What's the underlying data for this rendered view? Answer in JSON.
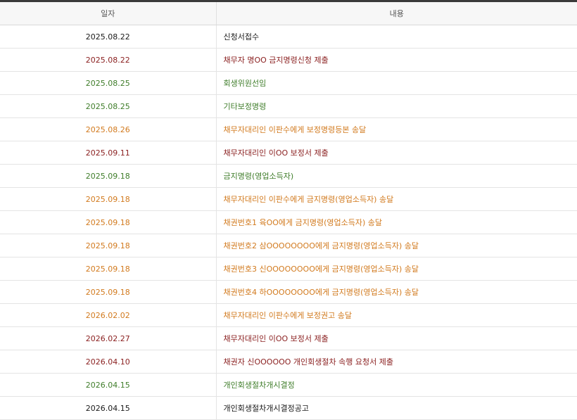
{
  "headers": {
    "date": "일자",
    "content": "내용"
  },
  "rows": [
    {
      "date": "2025.08.22",
      "content": "신청서접수",
      "color": "#1a1a1a"
    },
    {
      "date": "2025.08.22",
      "content": "채무자 명OO 금지명령신청 제출",
      "color": "#8a1f1f"
    },
    {
      "date": "2025.08.25",
      "content": "회생위원선임",
      "color": "#3f7d2a"
    },
    {
      "date": "2025.08.25",
      "content": "기타보정명령",
      "color": "#3f7d2a"
    },
    {
      "date": "2025.08.26",
      "content": "채무자대리인 이판수에게 보정명령등본 송달",
      "color": "#d27a1e"
    },
    {
      "date": "2025.09.11",
      "content": "채무자대리인 이OO 보정서 제출",
      "color": "#8a1f1f"
    },
    {
      "date": "2025.09.18",
      "content": "금지명령(영업소득자)",
      "color": "#3f7d2a"
    },
    {
      "date": "2025.09.18",
      "content": "채무자대리인 이판수에게 금지명령(영업소득자) 송달",
      "color": "#d27a1e"
    },
    {
      "date": "2025.09.18",
      "content": "채권번호1 육OO에게 금지명령(영업소득자) 송달",
      "color": "#d27a1e"
    },
    {
      "date": "2025.09.18",
      "content": "채권번호2 삼OOOOOOOO에게 금지명령(영업소득자) 송달",
      "color": "#d27a1e"
    },
    {
      "date": "2025.09.18",
      "content": "채권번호3 신OOOOOOOO에게 금지명령(영업소득자) 송달",
      "color": "#d27a1e"
    },
    {
      "date": "2025.09.18",
      "content": "채권번호4 하OOOOOOOO에게 금지명령(영업소득자) 송달",
      "color": "#d27a1e"
    },
    {
      "date": "2026.02.02",
      "content": "채무자대리인 이판수에게 보정권고 송달",
      "color": "#d27a1e"
    },
    {
      "date": "2026.02.27",
      "content": "채무자대리인 이OO 보정서 제출",
      "color": "#8a1f1f"
    },
    {
      "date": "2026.04.10",
      "content": "채권자 신OOOOOO 개인회생절차 속행 요청서 제출",
      "color": "#8a1f1f"
    },
    {
      "date": "2026.04.15",
      "content": "개인회생절차개시결정",
      "color": "#3f7d2a"
    },
    {
      "date": "2026.04.15",
      "content": "개인회생절차개시결정공고",
      "color": "#1a1a1a"
    }
  ]
}
